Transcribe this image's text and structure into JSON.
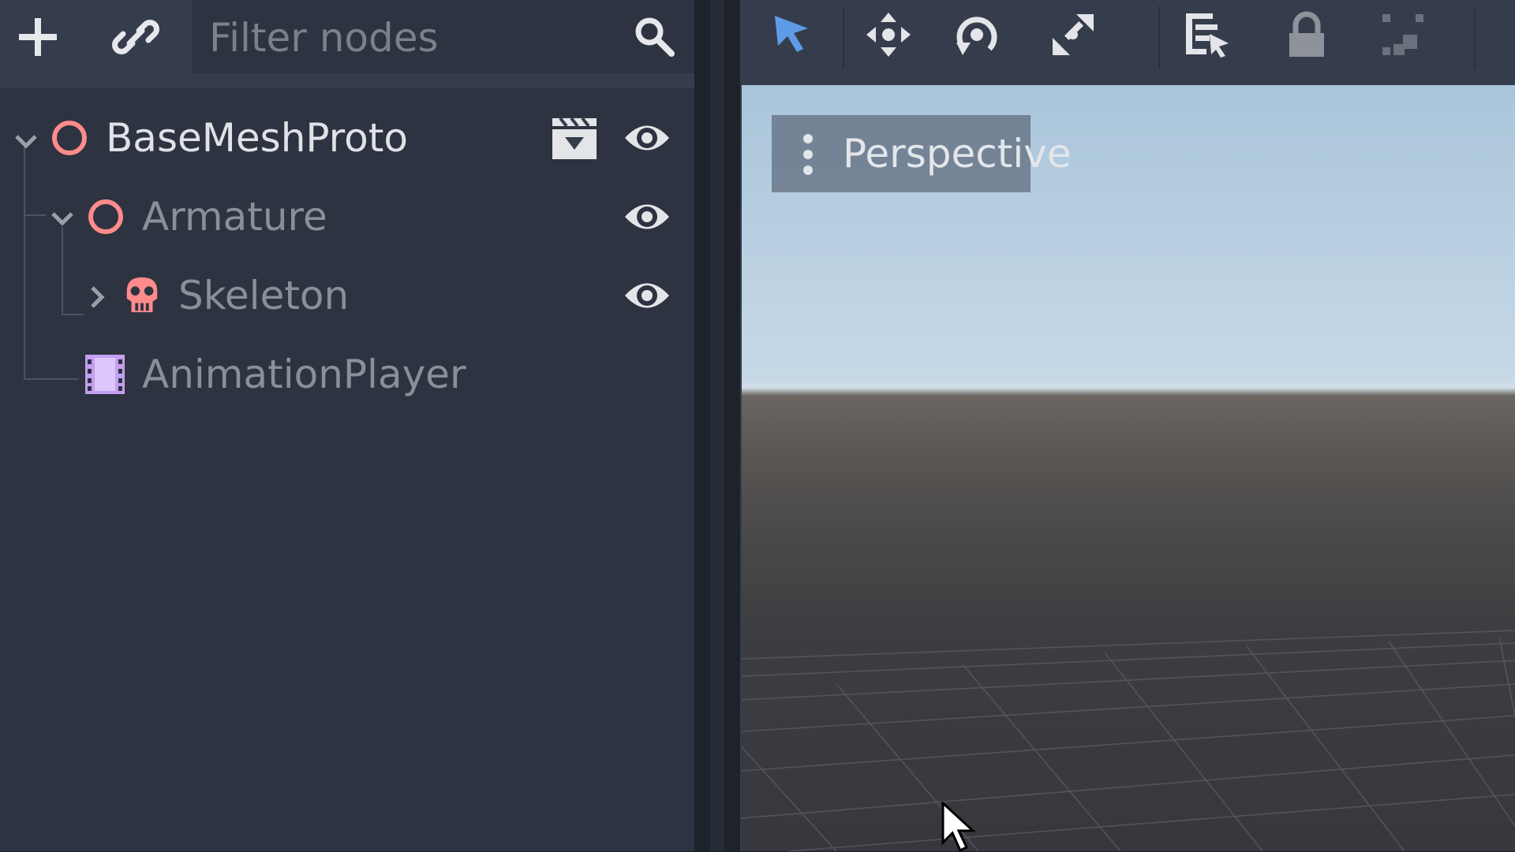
{
  "scene_dock": {
    "add_node_icon": "plus-icon",
    "link_icon": "link-icon",
    "filter": {
      "placeholder": "Filter nodes",
      "value": "",
      "search_icon": "search-icon"
    },
    "tree": [
      {
        "label": "BaseMeshProto",
        "icon": "spatial-node-icon",
        "expanded": true,
        "has_eye": true,
        "has_instance": true,
        "dimmed": false
      },
      {
        "label": "Armature",
        "icon": "spatial-node-icon",
        "expanded": true,
        "has_eye": true,
        "dimmed": true
      },
      {
        "label": "Skeleton",
        "icon": "skeleton-icon",
        "expanded": false,
        "has_eye": true,
        "dimmed": true
      },
      {
        "label": "AnimationPlayer",
        "icon": "animation-player-icon",
        "dimmed": true
      }
    ]
  },
  "viewport_toolbar": {
    "tools": [
      "select-tool-icon",
      "move-tool-icon",
      "rotate-tool-icon",
      "scale-tool-icon",
      "list-select-icon",
      "lock-icon",
      "group-icon"
    ],
    "active_tool": "select-tool-icon"
  },
  "viewport": {
    "view_menu_label": "Perspective",
    "view_menu_icon": "vertical-dots-icon"
  },
  "colors": {
    "accent": "#5f9ce8",
    "node_red": "#ff8b8b",
    "animation_purple": "#c49ef0",
    "text_primary": "#d8dbe0",
    "text_dimmed": "#8a909a",
    "sky_top": "#a9c4da",
    "ground": "#5d5955"
  }
}
